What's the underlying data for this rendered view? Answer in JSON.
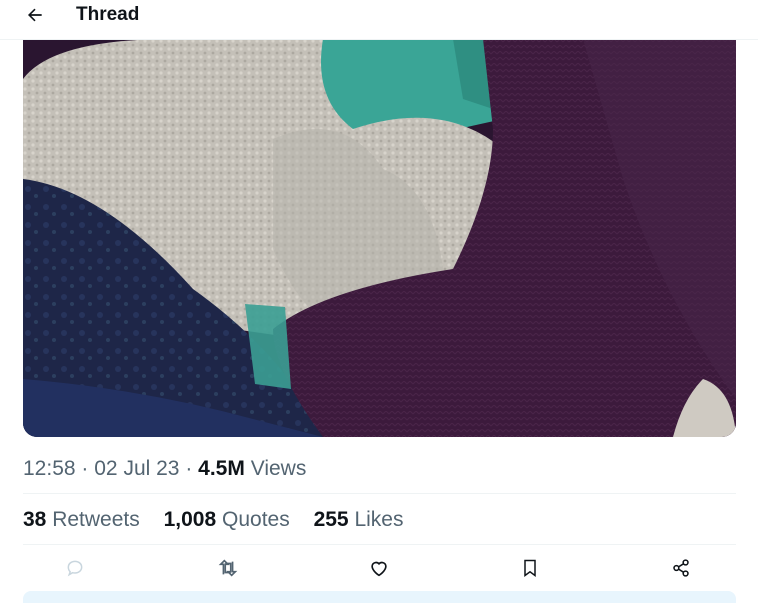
{
  "header": {
    "title": "Thread",
    "back_icon": "arrow-left-icon"
  },
  "media": {
    "description_icon": "photo"
  },
  "meta": {
    "time": "12:58",
    "date": "02 Jul 23",
    "views_count": "4.5M",
    "views_label": "Views",
    "separator": "·"
  },
  "stats": {
    "retweets_count": "38",
    "retweets_label": "Retweets",
    "quotes_count": "1,008",
    "quotes_label": "Quotes",
    "likes_count": "255",
    "likes_label": "Likes"
  },
  "actions": {
    "reply_icon": "reply-icon",
    "retweet_icon": "retweet-icon",
    "like_icon": "heart-icon",
    "bookmark_icon": "bookmark-icon",
    "share_icon": "share-icon"
  },
  "colors": {
    "text": "#0f1419",
    "muted": "#536471",
    "divider": "#eff3f4",
    "reply_icon": "#c9d6de"
  }
}
